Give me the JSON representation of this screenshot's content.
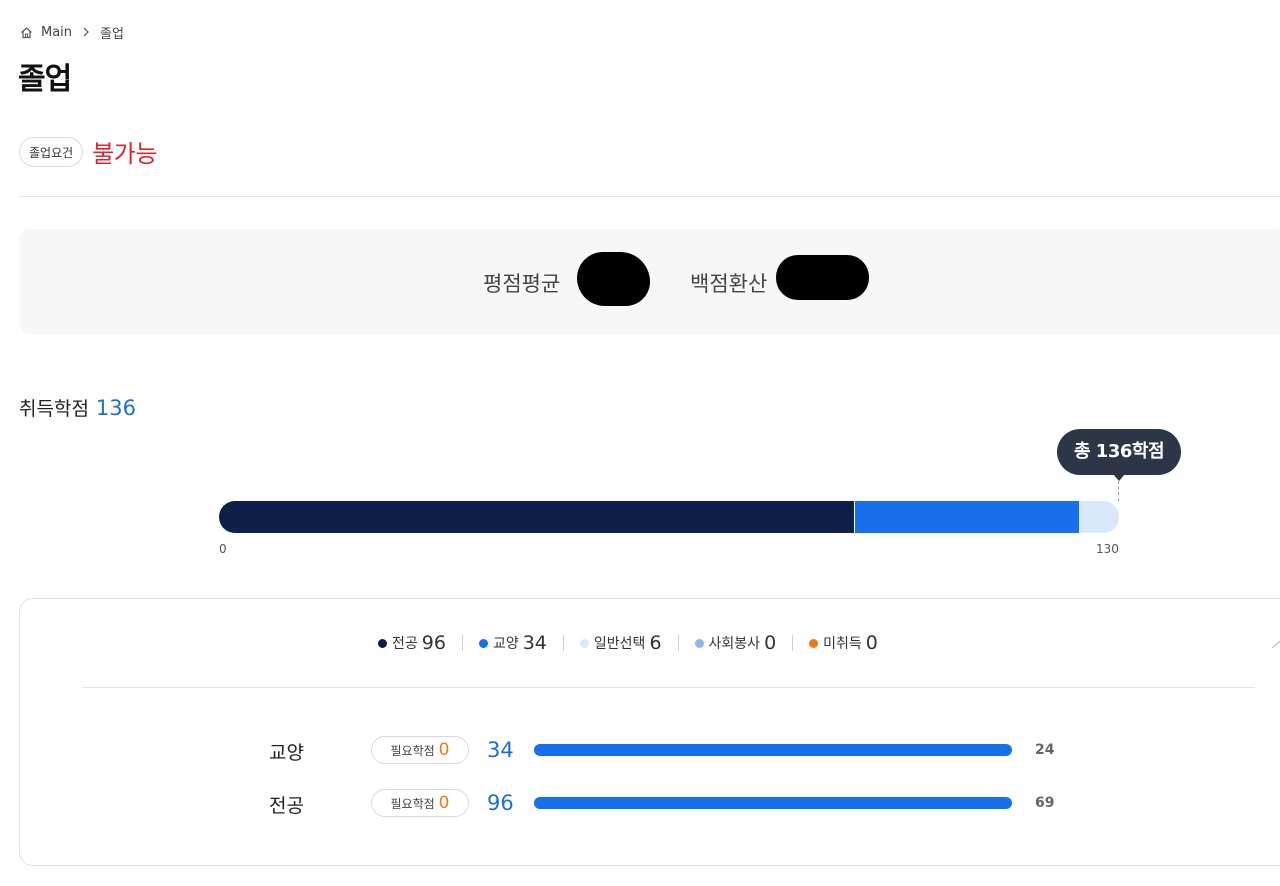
{
  "breadcrumb": {
    "home": "Main",
    "current": "졸업"
  },
  "page_title": "졸업",
  "requirement": {
    "label": "졸업요건",
    "status": "불가능",
    "status_color": "#e0242e"
  },
  "gpa": {
    "average_label": "평점평균",
    "percent_label": "백점환산"
  },
  "credits": {
    "label": "취득학점",
    "value": "136",
    "tooltip": "총 136학점",
    "axis_min": "0",
    "axis_max": "130",
    "segments": [
      {
        "name": "전공",
        "value": 96,
        "color": "#0d1f4a"
      },
      {
        "name": "교양",
        "value": 34,
        "color": "#1670ec"
      },
      {
        "name": "일반선택",
        "value": 6,
        "color": "#d9e8fb"
      }
    ]
  },
  "legend": [
    {
      "name": "전공",
      "count": "96",
      "color": "#0d1f4a"
    },
    {
      "name": "교양",
      "count": "34",
      "color": "#1670ec"
    },
    {
      "name": "일반선택",
      "count": "6",
      "color": "#dbe8fb"
    },
    {
      "name": "사회봉사",
      "count": "0",
      "color": "#8ab8f2"
    },
    {
      "name": "미취득",
      "count": "0",
      "color": "#f07a12"
    }
  ],
  "rows": [
    {
      "label": "교양",
      "req_label": "필요학점",
      "req_value": "0",
      "count": "34",
      "max": "24",
      "fill": 1.0
    },
    {
      "label": "전공",
      "req_label": "필요학점",
      "req_value": "0",
      "count": "96",
      "max": "69",
      "fill": 1.0
    }
  ]
}
